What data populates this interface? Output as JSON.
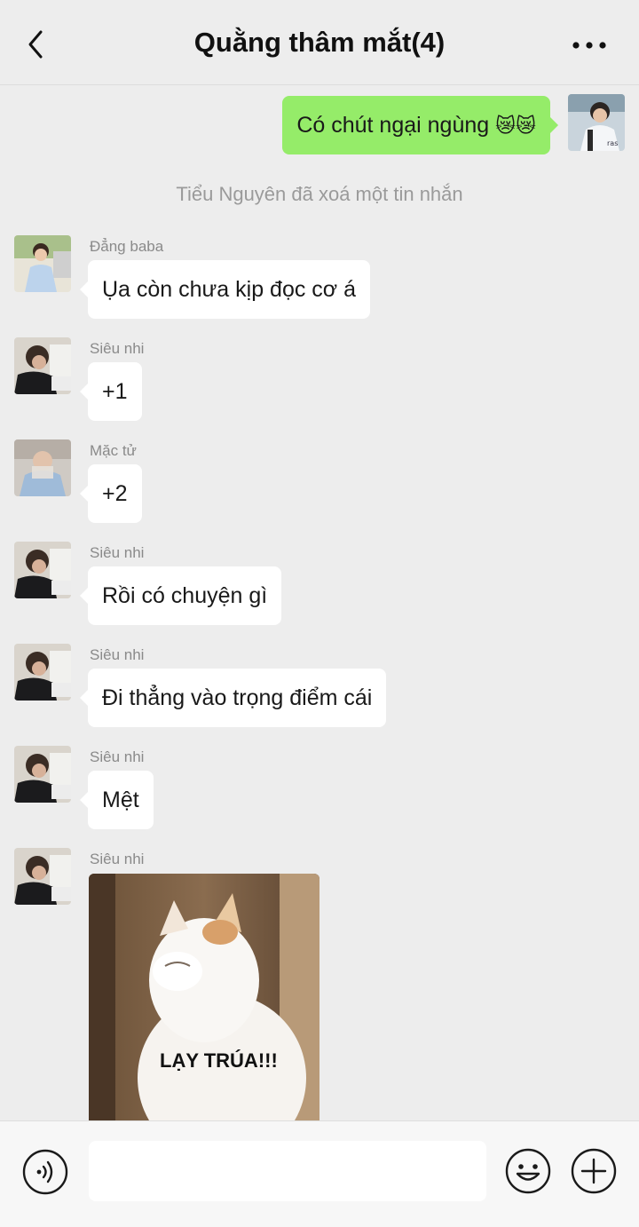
{
  "header": {
    "title": "Quằng thâm mắt(4)"
  },
  "chat": {
    "my_message": {
      "text": "Có chút ngại ngùng",
      "emoji": "😿😿"
    },
    "system_notice": "Tiểu Nguyên đã xoá một tin nhắn",
    "messages": [
      {
        "sender": "Đẳng baba",
        "text": "Ụa còn chưa kịp đọc cơ á"
      },
      {
        "sender": "Siêu nhi",
        "text": "+1"
      },
      {
        "sender": "Mặc tử",
        "text": "+2"
      },
      {
        "sender": "Siêu nhi",
        "text": "Rồi có chuyện gì"
      },
      {
        "sender": "Siêu nhi",
        "text": "Đi thẳng vào trọng điểm cái"
      },
      {
        "sender": "Siêu nhi",
        "text": "Mệt"
      }
    ],
    "image_message": {
      "sender": "Siêu nhi",
      "caption": "LẠY TRÚA!!!"
    }
  },
  "input_bar": {
    "placeholder": ""
  },
  "icons": {
    "back": "back-icon",
    "more": "more-icon",
    "voice": "voice-icon",
    "emoji": "emoji-icon",
    "plus": "plus-icon"
  },
  "colors": {
    "background": "#ededed",
    "my_bubble": "#95ec69",
    "other_bubble": "#ffffff"
  }
}
